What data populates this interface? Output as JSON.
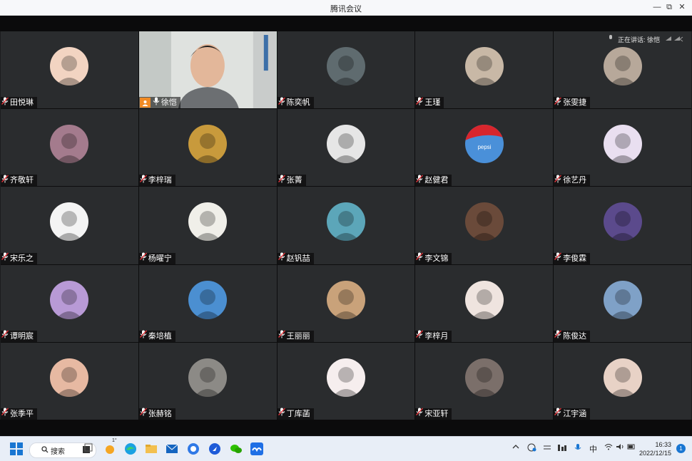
{
  "window": {
    "title": "腾讯会议",
    "minimize": "—",
    "restore": "⧉",
    "close": "✕"
  },
  "speaking": {
    "label": "正在讲话: 徐恺"
  },
  "participants": [
    {
      "name": "田悦琳",
      "avatar": "cartoon-cake-avatar",
      "color": "#f2d4c2"
    },
    {
      "name": "徐恺",
      "avatar": "live-video",
      "color": "#cfd2cf",
      "host": true
    },
    {
      "name": "陈奕帆",
      "avatar": "dark-figure-avatar",
      "color": "#5f6b6f"
    },
    {
      "name": "王瑾",
      "avatar": "couple-photo-avatar",
      "color": "#c8b8a6"
    },
    {
      "name": "张雯捷",
      "avatar": "girl-photo-avatar",
      "color": "#b7a89a"
    },
    {
      "name": "齐敬轩",
      "avatar": "sunset-avatar",
      "color": "#a47b8d"
    },
    {
      "name": "李梓瑞",
      "avatar": "anime-hat-avatar",
      "color": "#c89a3c"
    },
    {
      "name": "张菁",
      "avatar": "anime-bw-avatar",
      "color": "#e6e6e6"
    },
    {
      "name": "赵健君",
      "avatar": "pepsi-avatar",
      "color": "#4a90d9"
    },
    {
      "name": "徐艺丹",
      "avatar": "cartoon-girl-avatar",
      "color": "#e9dff0"
    },
    {
      "name": "宋乐之",
      "avatar": "manga-avatar",
      "color": "#f4f4f4"
    },
    {
      "name": "杨曜宁",
      "avatar": "snoopy-avatar",
      "color": "#f0efe9"
    },
    {
      "name": "赵钒喆",
      "avatar": "anime-boy-avatar",
      "color": "#5ca6b9"
    },
    {
      "name": "李文锦",
      "avatar": "night-photo-avatar",
      "color": "#6a4a3a"
    },
    {
      "name": "李俊霖",
      "avatar": "anime-man-avatar",
      "color": "#5b4a8c"
    },
    {
      "name": "谭明宸",
      "avatar": "anime-purple-avatar",
      "color": "#b89ad6"
    },
    {
      "name": "秦培植",
      "avatar": "sky-avatar",
      "color": "#4b8fd1"
    },
    {
      "name": "王丽丽",
      "avatar": "woman-photo-avatar",
      "color": "#c9a27a"
    },
    {
      "name": "李梓月",
      "avatar": "drawn-girl-avatar",
      "color": "#efe4df"
    },
    {
      "name": "陈俊达",
      "avatar": "mountain-avatar",
      "color": "#7fa1c7"
    },
    {
      "name": "张季平",
      "avatar": "flower-girl-avatar",
      "color": "#e7b9a2"
    },
    {
      "name": "张赫铭",
      "avatar": "cat-photo-avatar",
      "color": "#8c8a86"
    },
    {
      "name": "丁库菡",
      "avatar": "chibi-girl-avatar",
      "color": "#f6eeee"
    },
    {
      "name": "宋亚轩",
      "avatar": "cat-dark-avatar",
      "color": "#7b6f6a"
    },
    {
      "name": "江宇涵",
      "avatar": "baby-photo-avatar",
      "color": "#e8d2c6"
    }
  ],
  "pepsi_text": "pepsi",
  "taskbar": {
    "search_label": "搜索",
    "edge_badge": "1°",
    "ime": "中",
    "time": "16:33",
    "date": "2022/12/15",
    "notifications": "1"
  }
}
